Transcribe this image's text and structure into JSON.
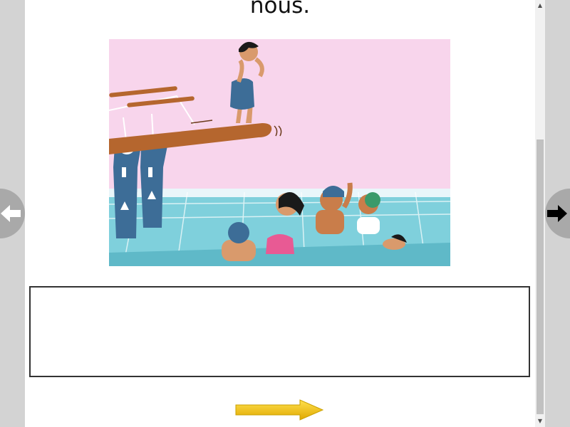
{
  "heading": {
    "text": "nous."
  },
  "illustration": {
    "colors": {
      "sky": "#f8d5ec",
      "water": "#7fd0dc",
      "board": "#b5662e",
      "tower": "#3d6d97"
    }
  },
  "answer_box": {
    "value": ""
  },
  "icons": {
    "next_arrow": "yellow-right-arrow-icon",
    "prev_page": "left-arrow-icon",
    "next_page": "right-arrow-icon"
  },
  "colors": {
    "page_background": "#d3d3d3",
    "arrow_yellow": "#f2c200",
    "nav_circle": "#a9a9a9"
  }
}
